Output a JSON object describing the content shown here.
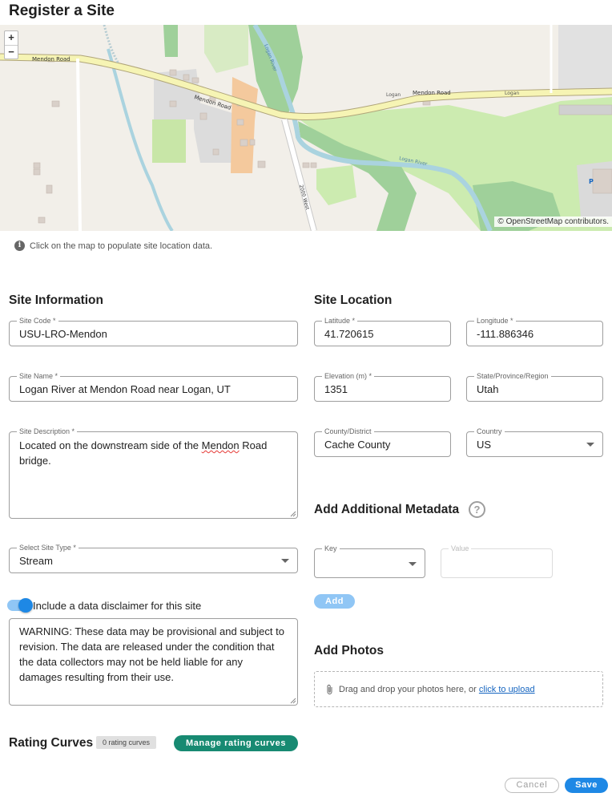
{
  "page": {
    "title": "Register a Site"
  },
  "map": {
    "roads": {
      "mendon_west": "Mendon Road",
      "mendon_curve": "Mendon Road",
      "mendon_east": "Mendon Road",
      "logan_left": "Logan",
      "logan_right": "Logan",
      "west_2000": "2000 West",
      "river": "Logan River",
      "river_small": "Logan River"
    },
    "zoom_in": "+",
    "zoom_out": "−",
    "attribution_prefix": "© ",
    "attribution_link": "OpenStreetMap",
    "attribution_suffix": " contributors."
  },
  "hint": {
    "icon": "i",
    "text": "Click on the map to populate site location data."
  },
  "site_info": {
    "heading": "Site Information",
    "code": {
      "label": "Site Code *",
      "value": "USU-LRO-Mendon"
    },
    "name": {
      "label": "Site Name *",
      "value": "Logan River at Mendon Road near Logan, UT"
    },
    "description": {
      "label": "Site Description *",
      "value_pre": "Located on the downstream side of the ",
      "value_spell": "Mendon",
      "value_post": " Road bridge."
    },
    "type": {
      "label": "Select Site Type *",
      "value": "Stream"
    },
    "disclaimer_toggle": {
      "label": "Include a data disclaimer for this site",
      "on": true
    },
    "disclaimer_text": "WARNING: These data may be provisional and subject to revision. The data are released under the condition that the data collectors may not be held liable for any damages resulting from their use."
  },
  "site_location": {
    "heading": "Site Location",
    "latitude": {
      "label": "Latitude *",
      "value": "41.720615"
    },
    "longitude": {
      "label": "Longitude *",
      "value": "-111.886346"
    },
    "elevation": {
      "label": "Elevation (m) *",
      "value": "1351"
    },
    "state": {
      "label": "State/Province/Region",
      "value": "Utah"
    },
    "county": {
      "label": "County/District",
      "value": "Cache County"
    },
    "country": {
      "label": "Country",
      "value": "US"
    }
  },
  "metadata": {
    "heading": "Add Additional Metadata",
    "help_icon": "?",
    "key_label": "Key",
    "value_label": "Value",
    "add_label": "Add"
  },
  "photos": {
    "heading": "Add Photos",
    "drop_text": "Drag and drop your photos here, or ",
    "upload_link": "click to upload"
  },
  "rating_curves": {
    "heading": "Rating Curves",
    "count_badge": "0 rating curves",
    "manage_label": "Manage rating curves"
  },
  "footer": {
    "cancel_label": "Cancel",
    "save_label": "Save"
  },
  "colors": {
    "primary": "#1e88e5",
    "teal": "#178a72",
    "primary_light": "#90c6f5"
  }
}
